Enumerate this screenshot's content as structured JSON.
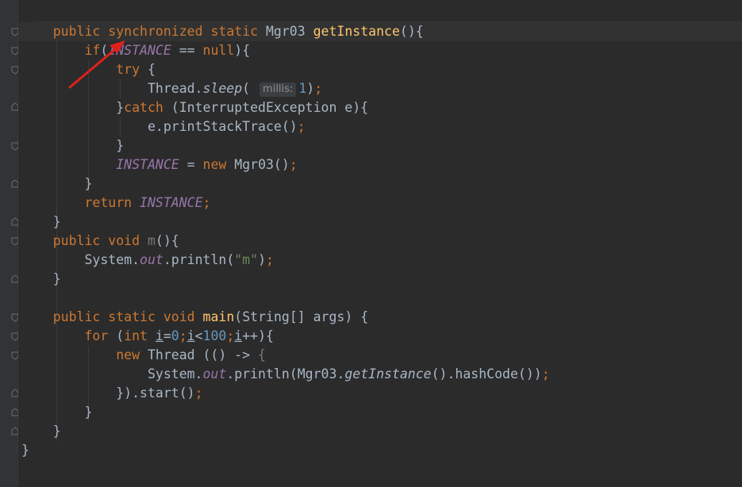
{
  "colors": {
    "background": "#2b2b2b",
    "keyword": "#cc7832",
    "method_declaration": "#ffc66d",
    "static_field": "#9876aa",
    "number": "#6897bb",
    "string": "#6a8759",
    "plain": "#a9b7c6",
    "annotation_arrow": "#e0201b"
  },
  "code": {
    "l1": {
      "public": "public",
      "synchronized": "synchronized",
      "static": "static",
      "type": "Mgr03",
      "method": "getInstance",
      "tail": "(){"
    },
    "l2": {
      "if": "if",
      "open": "(",
      "field": "INSTANCE",
      "op": " == ",
      "null": "null",
      "tail": "){"
    },
    "l3": {
      "try": "try",
      "tail": " {"
    },
    "l4": {
      "cls": "Thread.",
      "method": "sleep",
      "open": "( ",
      "hint": "millis:",
      "num": "1",
      "close": ")",
      "semi": ";"
    },
    "l5": {
      "open": "}",
      "catch": "catch",
      "tail": " (InterruptedException e){"
    },
    "l6": {
      "text": "e.printStackTrace()",
      "semi": ";"
    },
    "l7": {
      "text": "}"
    },
    "l8": {
      "field": "INSTANCE",
      "op": " = ",
      "new": "new",
      "tail": " Mgr03()",
      "semi": ";"
    },
    "l9": {
      "text": "}"
    },
    "l10": {
      "return": "return",
      "field": "INSTANCE",
      "semi": ";"
    },
    "l11": {
      "text": "}"
    },
    "l12": {
      "public": "public",
      "void": "void",
      "name": "m",
      "tail": "(){"
    },
    "l13": {
      "cls": "System.",
      "out": "out",
      "mid": ".println(",
      "str": "\"m\"",
      "close": ")",
      "semi": ";"
    },
    "l14": {
      "text": "}"
    },
    "l16": {
      "public": "public",
      "static": "static",
      "void": "void",
      "method": "main",
      "tail": "(String[] args) {"
    },
    "l17": {
      "for": "for",
      "open": " (",
      "int": "int",
      "i1": "i",
      "eq": "=",
      "n0": "0",
      "s1": ";",
      "i2": "i",
      "lt": "<",
      "n100": "100",
      "s2": ";",
      "i3": "i",
      "tail": "++){"
    },
    "l18": {
      "new": "new",
      "mid": " Thread (() -> ",
      "brace": "{"
    },
    "l19": {
      "cls": "System.",
      "out": "out",
      "mid": ".println(Mgr03.",
      "method": "getInstance",
      "tail": "().hashCode())",
      "semi": ";"
    },
    "l20": {
      "text": "}).start()",
      "semi": ";"
    },
    "l21": {
      "text": "}"
    },
    "l22": {
      "text": "}"
    },
    "l23": {
      "text": "}"
    }
  }
}
